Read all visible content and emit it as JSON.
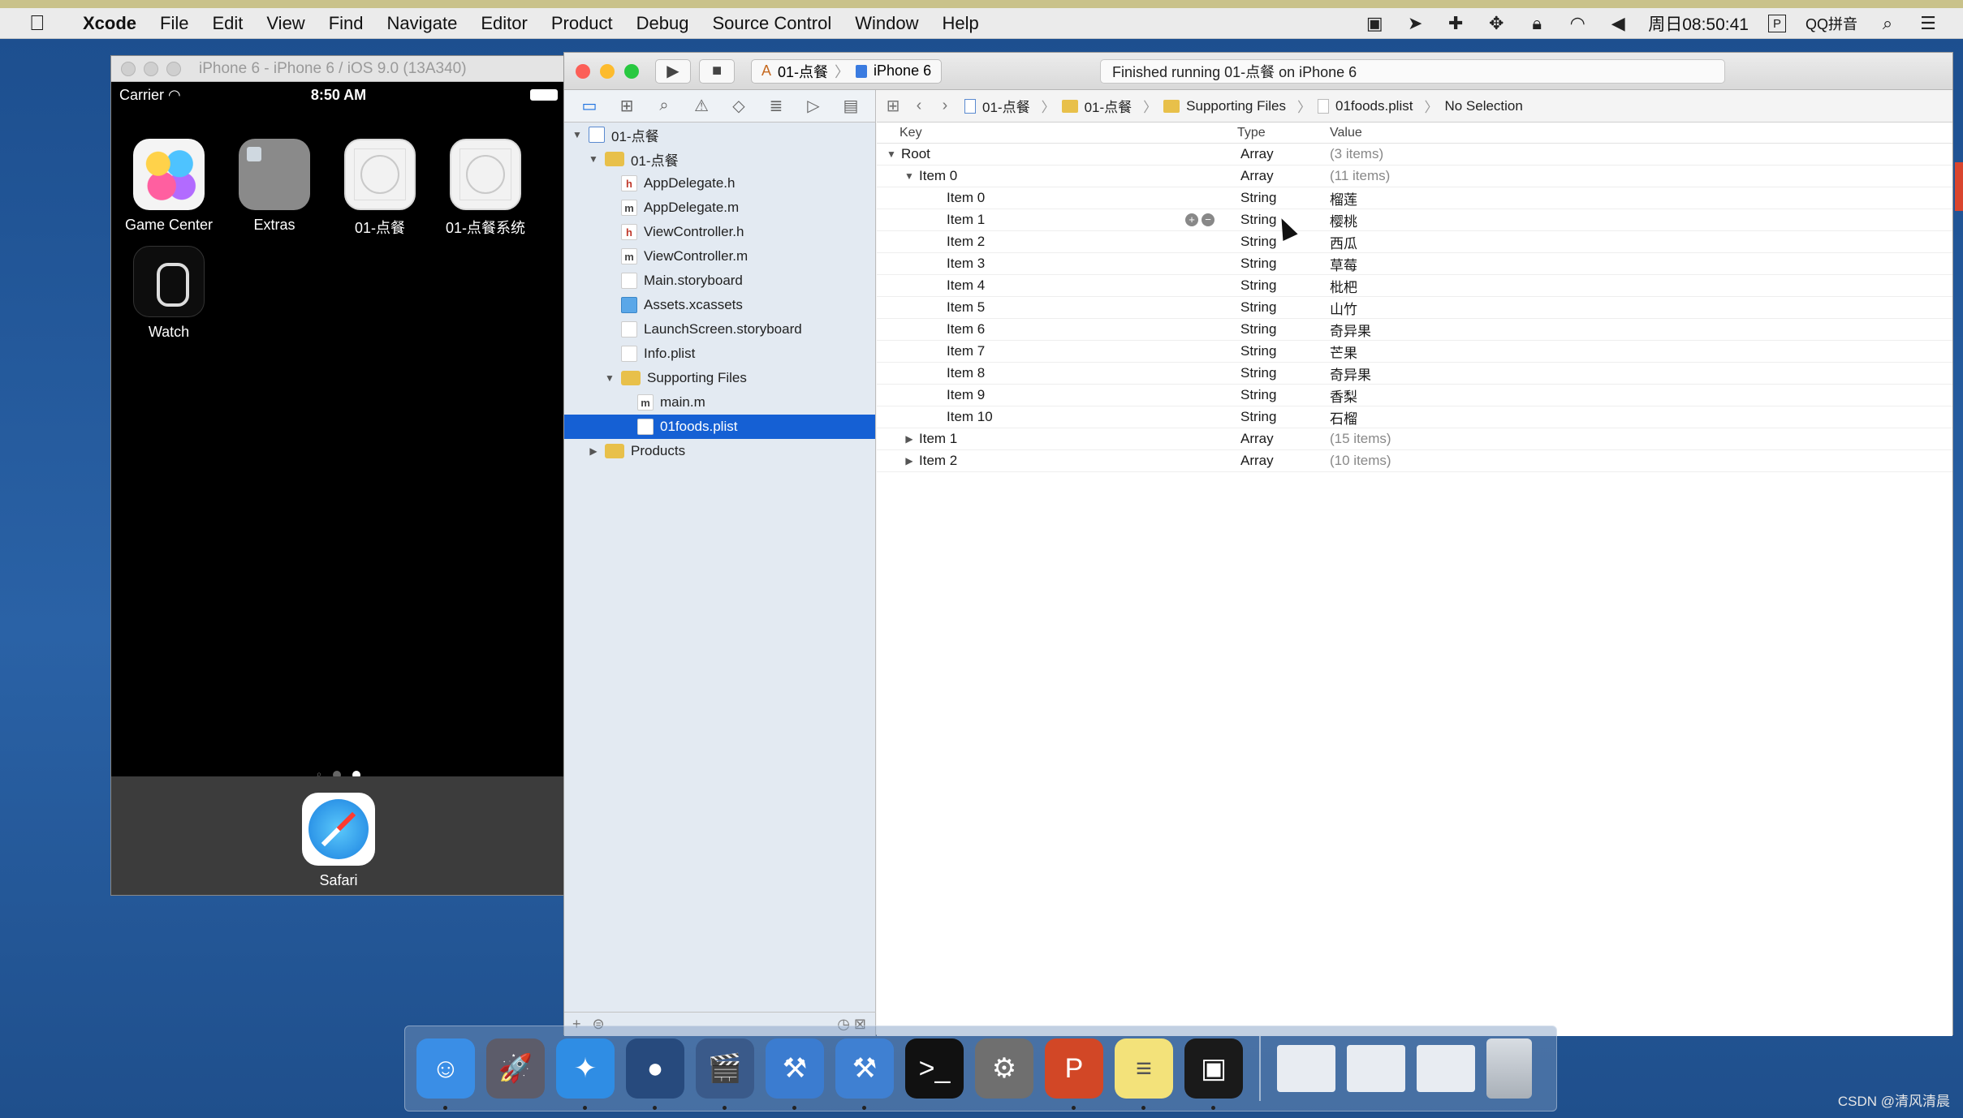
{
  "menubar": {
    "app_name": "Xcode",
    "items": [
      "File",
      "Edit",
      "View",
      "Find",
      "Navigate",
      "Editor",
      "Product",
      "Debug",
      "Source Control",
      "Window",
      "Help"
    ],
    "clock": "周日08:50:41",
    "input_method": "QQ拼音"
  },
  "simulator": {
    "window_title": "iPhone 6 - iPhone 6 / iOS 9.0 (13A340)",
    "carrier": "Carrier",
    "time": "8:50 AM",
    "apps": [
      {
        "label": "Game Center",
        "icon": "game-center-icon"
      },
      {
        "label": "Extras",
        "icon": "folder-icon"
      },
      {
        "label": "01-点餐",
        "icon": "app-placeholder-icon"
      },
      {
        "label": "01-点餐系统",
        "icon": "app-placeholder-icon"
      },
      {
        "label": "Watch",
        "icon": "watch-icon"
      }
    ],
    "dock_app": "Safari"
  },
  "xcode": {
    "scheme": "01-点餐",
    "device": "iPhone 6",
    "status": "Finished running 01-点餐 on iPhone 6",
    "navigator": [
      {
        "label": "01-点餐",
        "kind": "proj",
        "level": 0,
        "disclosure": "open"
      },
      {
        "label": "01-点餐",
        "kind": "folder",
        "level": 1,
        "disclosure": "open"
      },
      {
        "label": "AppDelegate.h",
        "kind": "h",
        "level": 2
      },
      {
        "label": "AppDelegate.m",
        "kind": "m",
        "level": 2
      },
      {
        "label": "ViewController.h",
        "kind": "h",
        "level": 2
      },
      {
        "label": "ViewController.m",
        "kind": "m",
        "level": 2
      },
      {
        "label": "Main.storyboard",
        "kind": "sb",
        "level": 2
      },
      {
        "label": "Assets.xcassets",
        "kind": "xc",
        "level": 2
      },
      {
        "label": "LaunchScreen.storyboard",
        "kind": "sb",
        "level": 2
      },
      {
        "label": "Info.plist",
        "kind": "pl",
        "level": 2
      },
      {
        "label": "Supporting Files",
        "kind": "folder",
        "level": 2,
        "disclosure": "open"
      },
      {
        "label": "main.m",
        "kind": "m",
        "level": 3
      },
      {
        "label": "01foods.plist",
        "kind": "pl",
        "level": 3,
        "selected": true
      },
      {
        "label": "Products",
        "kind": "folder",
        "level": 1,
        "disclosure": "closed"
      }
    ],
    "jumpbar": [
      "01-点餐",
      "01-点餐",
      "Supporting Files",
      "01foods.plist",
      "No Selection"
    ],
    "plist_headers": {
      "key": "Key",
      "type": "Type",
      "value": "Value"
    },
    "plist_rows": [
      {
        "key": "Root",
        "type": "Array",
        "value": "(3 items)",
        "level": 0,
        "disclosure": "open",
        "dim": true
      },
      {
        "key": "Item 0",
        "type": "Array",
        "value": "(11 items)",
        "level": 1,
        "disclosure": "open",
        "dim": true
      },
      {
        "key": "Item 0",
        "type": "String",
        "value": "榴莲",
        "level": 2
      },
      {
        "key": "Item 1",
        "type": "String",
        "value": "樱桃",
        "level": 2,
        "controls": true
      },
      {
        "key": "Item 2",
        "type": "String",
        "value": "西瓜",
        "level": 2
      },
      {
        "key": "Item 3",
        "type": "String",
        "value": "草莓",
        "level": 2
      },
      {
        "key": "Item 4",
        "type": "String",
        "value": "枇杷",
        "level": 2
      },
      {
        "key": "Item 5",
        "type": "String",
        "value": "山竹",
        "level": 2
      },
      {
        "key": "Item 6",
        "type": "String",
        "value": "奇异果",
        "level": 2
      },
      {
        "key": "Item 7",
        "type": "String",
        "value": "芒果",
        "level": 2
      },
      {
        "key": "Item 8",
        "type": "String",
        "value": "奇异果",
        "level": 2
      },
      {
        "key": "Item 9",
        "type": "String",
        "value": "香梨",
        "level": 2
      },
      {
        "key": "Item 10",
        "type": "String",
        "value": "石榴",
        "level": 2
      },
      {
        "key": "Item 1",
        "type": "Array",
        "value": "(15 items)",
        "level": 1,
        "disclosure": "closed",
        "dim": true
      },
      {
        "key": "Item 2",
        "type": "Array",
        "value": "(10 items)",
        "level": 1,
        "disclosure": "closed",
        "dim": true
      }
    ]
  },
  "mac_dock": [
    {
      "name": "finder",
      "color": "#3a8ee6",
      "glyph": "☺",
      "running": true
    },
    {
      "name": "launchpad",
      "color": "#5c5c6a",
      "glyph": "🚀",
      "running": false
    },
    {
      "name": "safari",
      "color": "#2f8de4",
      "glyph": "✦",
      "running": true
    },
    {
      "name": "mouse",
      "color": "#274a7d",
      "glyph": "●",
      "running": true
    },
    {
      "name": "imovie",
      "color": "#3a5a8a",
      "glyph": "🎬",
      "running": true
    },
    {
      "name": "xcode",
      "color": "#3b7cd0",
      "glyph": "⚒",
      "running": true
    },
    {
      "name": "instruments",
      "color": "#3f80d2",
      "glyph": "⚒",
      "running": true
    },
    {
      "name": "terminal",
      "color": "#111111",
      "glyph": ">_",
      "running": false
    },
    {
      "name": "system-preferences",
      "color": "#6f6f6f",
      "glyph": "⚙",
      "running": false
    },
    {
      "name": "powerpoint",
      "color": "#d24726",
      "glyph": "P",
      "running": true
    },
    {
      "name": "notes",
      "color": "#f3e27a",
      "glyph": "≡",
      "running": true
    },
    {
      "name": "exec",
      "color": "#1a1a1a",
      "glyph": "▣",
      "running": true
    }
  ],
  "watermark": "CSDN @清风清晨"
}
